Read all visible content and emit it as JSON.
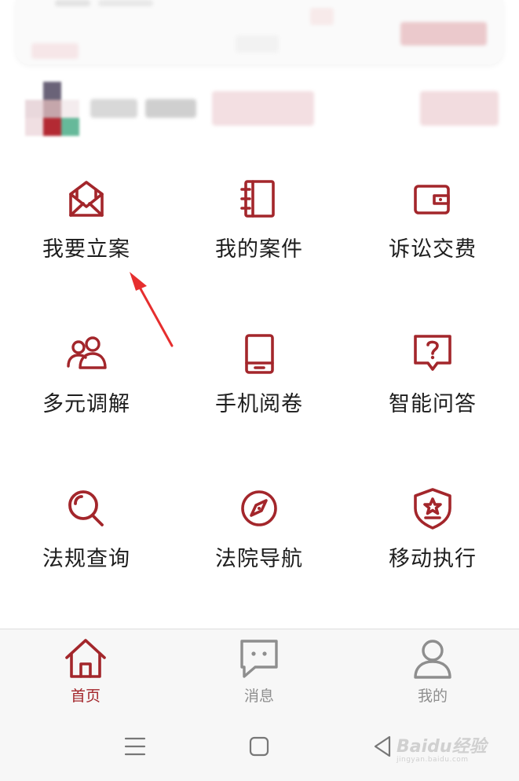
{
  "colors": {
    "accent": "#a3262b",
    "inactive": "#8e8e8e",
    "arrow": "#e62e2e"
  },
  "grid": {
    "items": [
      {
        "label": "我要立案",
        "icon": "envelope-icon"
      },
      {
        "label": "我的案件",
        "icon": "notebook-icon"
      },
      {
        "label": "诉讼交费",
        "icon": "wallet-icon"
      },
      {
        "label": "多元调解",
        "icon": "users-icon"
      },
      {
        "label": "手机阅卷",
        "icon": "tablet-icon"
      },
      {
        "label": "智能问答",
        "icon": "question-bubble-icon"
      },
      {
        "label": "法规查询",
        "icon": "search-icon"
      },
      {
        "label": "法院导航",
        "icon": "compass-icon"
      },
      {
        "label": "移动执行",
        "icon": "shield-star-icon"
      }
    ]
  },
  "tabbar": {
    "tabs": [
      {
        "label": "首页",
        "icon": "home-icon",
        "active": true
      },
      {
        "label": "消息",
        "icon": "message-icon",
        "active": false
      },
      {
        "label": "我的",
        "icon": "person-icon",
        "active": false
      }
    ]
  },
  "watermark": {
    "brand": "Baidu",
    "suffix": "经验",
    "url": "jingyan.baidu.com"
  }
}
